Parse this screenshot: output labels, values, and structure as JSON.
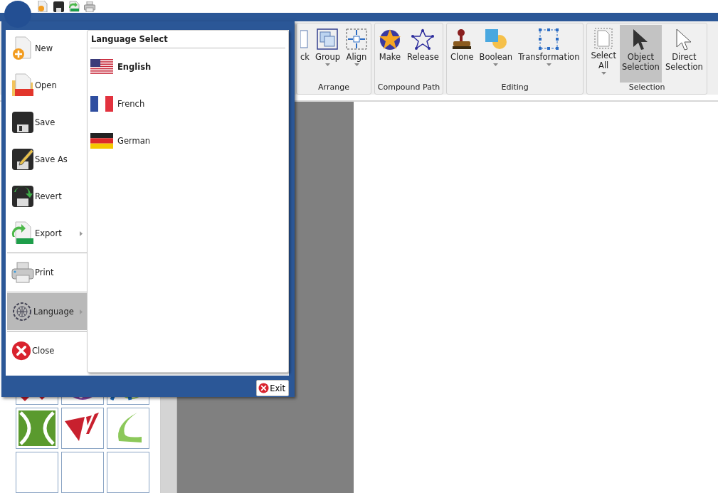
{
  "menu": {
    "items": [
      {
        "kind": "new",
        "label": "New",
        "has_submenu": false,
        "selected": false
      },
      {
        "kind": "open",
        "label": "Open",
        "has_submenu": false,
        "selected": false
      },
      {
        "kind": "save",
        "label": "Save",
        "has_submenu": false,
        "selected": false
      },
      {
        "kind": "saveas",
        "label": "Save As",
        "has_submenu": false,
        "selected": false
      },
      {
        "kind": "revert",
        "label": "Revert",
        "has_submenu": false,
        "selected": false
      },
      {
        "kind": "export",
        "label": "Export",
        "has_submenu": true,
        "selected": false,
        "divider_after": true
      },
      {
        "kind": "print",
        "label": "Print",
        "has_submenu": false,
        "selected": false,
        "divider_after": true
      },
      {
        "kind": "language",
        "label": "Language",
        "has_submenu": true,
        "selected": true,
        "divider_after": true
      },
      {
        "kind": "close",
        "label": "Close",
        "has_submenu": false,
        "selected": false
      }
    ],
    "submenu": {
      "title": "Language Select",
      "languages": [
        {
          "kind": "us",
          "label": "English",
          "selected": true
        },
        {
          "kind": "fr",
          "label": "French",
          "selected": false
        },
        {
          "kind": "de",
          "label": "German",
          "selected": false
        }
      ]
    },
    "exit_button": "Exit"
  },
  "ribbon": {
    "groups": [
      {
        "label": "Arrange",
        "items": [
          {
            "kind": "lock",
            "label": "ck",
            "dropdown": false,
            "selected": false
          },
          {
            "kind": "group",
            "label": "Group",
            "dropdown": true,
            "selected": false
          },
          {
            "kind": "align",
            "label": "Align",
            "dropdown": true,
            "selected": false
          }
        ]
      },
      {
        "label": "Compound Path",
        "items": [
          {
            "kind": "make",
            "label": "Make",
            "dropdown": false,
            "selected": false
          },
          {
            "kind": "release",
            "label": "Release",
            "dropdown": false,
            "selected": false
          }
        ]
      },
      {
        "label": "Editing",
        "items": [
          {
            "kind": "clone",
            "label": "Clone",
            "dropdown": false,
            "selected": false
          },
          {
            "kind": "boolean",
            "label": "Boolean",
            "dropdown": true,
            "selected": false
          },
          {
            "kind": "transform",
            "label": "Transformation",
            "dropdown": true,
            "selected": false
          }
        ]
      },
      {
        "label": "Selection",
        "items": [
          {
            "kind": "selectall",
            "label": "Select All",
            "dropdown": true,
            "selected": false
          },
          {
            "kind": "objsel",
            "label": "Object Selection",
            "dropdown": false,
            "selected": true
          },
          {
            "kind": "directsel",
            "label": "Direct Selection",
            "dropdown": false,
            "selected": false
          }
        ]
      }
    ]
  }
}
